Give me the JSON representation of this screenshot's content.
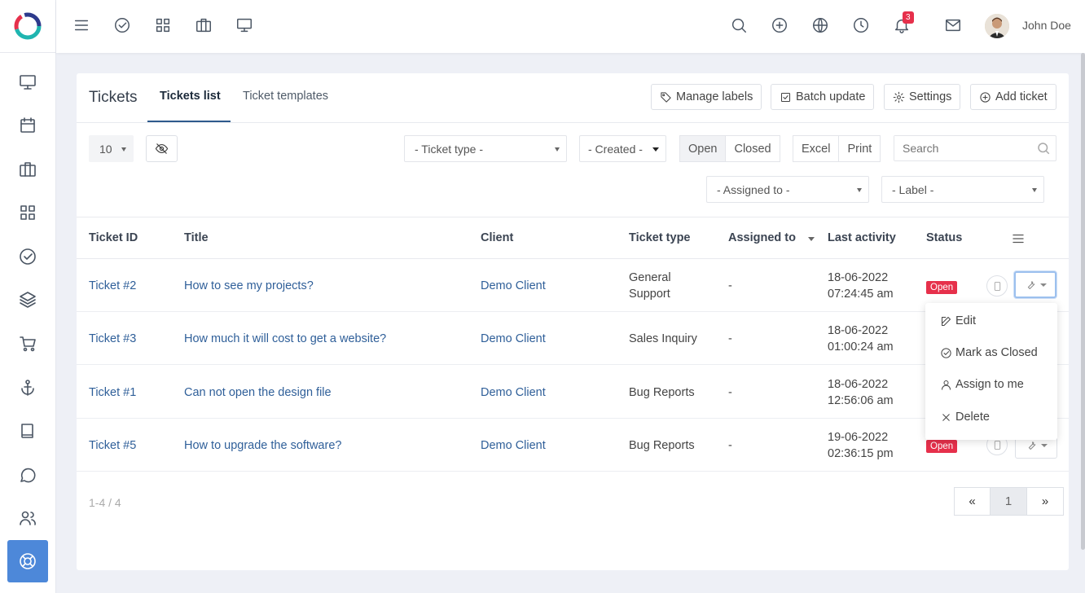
{
  "topbar": {
    "notification_count": "3",
    "user_name": "John Doe"
  },
  "card": {
    "title": "Tickets",
    "tabs": [
      "Tickets list",
      "Ticket templates"
    ],
    "buttons": {
      "manage_labels": "Manage labels",
      "batch_update": "Batch update",
      "settings": "Settings",
      "add_ticket": "Add ticket"
    }
  },
  "filters": {
    "page_size": "10",
    "ticket_type": "- Ticket type -",
    "created": "- Created -",
    "status_open": "Open",
    "status_closed": "Closed",
    "excel": "Excel",
    "print": "Print",
    "search_placeholder": "Search",
    "assigned_to": "- Assigned to -",
    "label": "- Label -"
  },
  "table": {
    "headers": [
      "Ticket ID",
      "Title",
      "Client",
      "Ticket type",
      "Assigned to",
      "Last activity",
      "Status"
    ],
    "rows": [
      {
        "id": "Ticket #2",
        "title": "How to see my projects?",
        "client": "Demo Client",
        "type_line1": "General",
        "type_line2": "Support",
        "assigned": "-",
        "date": "18-06-2022",
        "time": "07:24:45 am",
        "status": "Open"
      },
      {
        "id": "Ticket #3",
        "title": "How much it will cost to get a website?",
        "client": "Demo Client",
        "type_line1": "Sales Inquiry",
        "type_line2": "",
        "assigned": "-",
        "date": "18-06-2022",
        "time": "01:00:24 am",
        "status": ""
      },
      {
        "id": "Ticket #1",
        "title": "Can not open the design file",
        "client": "Demo Client",
        "type_line1": "Bug Reports",
        "type_line2": "",
        "assigned": "-",
        "date": "18-06-2022",
        "time": "12:56:06 am",
        "status": ""
      },
      {
        "id": "Ticket #5",
        "title": "How to upgrade the software?",
        "client": "Demo Client",
        "type_line1": "Bug Reports",
        "type_line2": "",
        "assigned": "-",
        "date": "19-06-2022",
        "time": "02:36:15 pm",
        "status": "Open"
      }
    ]
  },
  "dropdown": {
    "edit": "Edit",
    "mark_closed": "Mark as Closed",
    "assign_me": "Assign to me",
    "delete": "Delete"
  },
  "pagination": {
    "summary": "1-4 / 4",
    "prev": "«",
    "current": "1",
    "next": "»"
  },
  "colors": {
    "accent": "#4d88d9",
    "status_open": "#e6304b",
    "link": "#2f5f99"
  }
}
